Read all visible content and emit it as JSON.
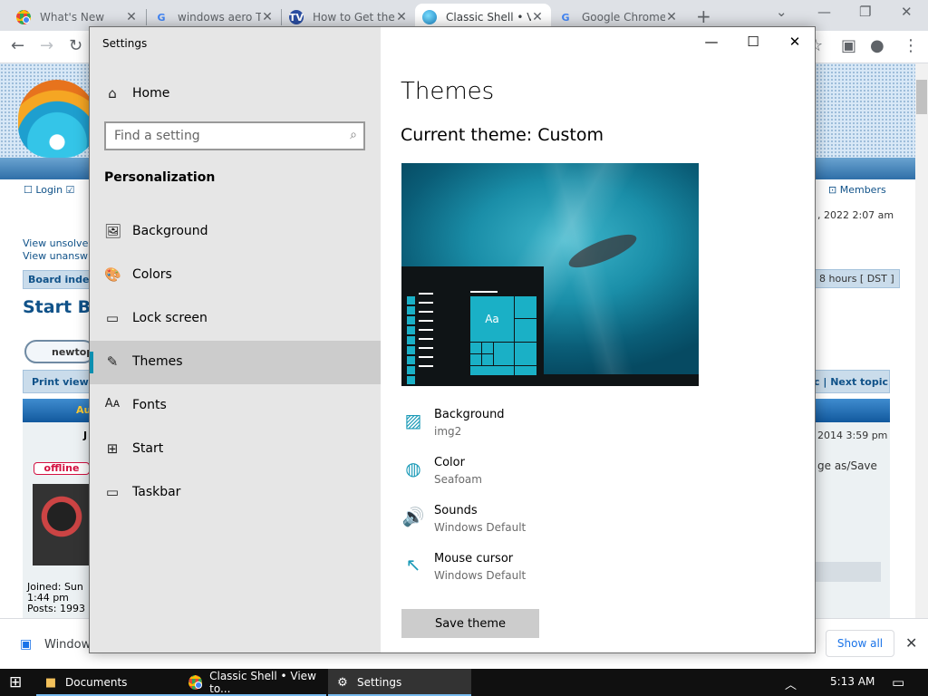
{
  "browser": {
    "tabs": [
      {
        "label": "What's New",
        "favicon": "chrome-icon"
      },
      {
        "label": "windows aero T",
        "favicon": "google-icon"
      },
      {
        "label": "How to Get the",
        "favicon": "tv-icon"
      },
      {
        "label": "Classic Shell • V",
        "favicon": "classic-shell-icon"
      },
      {
        "label": "Google Chrome",
        "favicon": "google-icon"
      }
    ],
    "active_tab": 3
  },
  "forum": {
    "login": "Login",
    "members": "Members",
    "date": ", 2022 2:07 am",
    "unsolved": "View unsolve",
    "unanswered": "View unansw",
    "board_index": "Board index",
    "timezone": "8 hours [ DST ]",
    "title": "Start Bu",
    "new_topic": "newtop",
    "print_view": "Print view",
    "next_topic": "c | Next topic",
    "blue_letters": "Au",
    "author_initial": "J",
    "post_date": "2014 3:59 pm",
    "post_snippet": "ge as/Save",
    "offline": "offline",
    "joined": "Joined: Sun",
    "joined_time": "1:44 pm",
    "posts": "Posts: 1993"
  },
  "downloads": {
    "item": "Windows",
    "show_all": "Show all"
  },
  "settings": {
    "window_title": "Settings",
    "home": "Home",
    "search_placeholder": "Find a setting",
    "section": "Personalization",
    "nav": [
      {
        "label": "Background",
        "icon": "picture-icon"
      },
      {
        "label": "Colors",
        "icon": "palette-icon"
      },
      {
        "label": "Lock screen",
        "icon": "lock-screen-icon"
      },
      {
        "label": "Themes",
        "icon": "brush-icon",
        "selected": true
      },
      {
        "label": "Fonts",
        "icon": "fonts-icon"
      },
      {
        "label": "Start",
        "icon": "start-icon"
      },
      {
        "label": "Taskbar",
        "icon": "taskbar-icon"
      }
    ],
    "heading": "Themes",
    "current_theme": "Current theme: Custom",
    "preview_tile_text": "Aa",
    "properties": [
      {
        "name": "Background",
        "value": "img2",
        "icon": "picture-icon"
      },
      {
        "name": "Color",
        "value": "Seafoam",
        "icon": "palette-icon"
      },
      {
        "name": "Sounds",
        "value": "Windows Default",
        "icon": "speaker-icon"
      },
      {
        "name": "Mouse cursor",
        "value": "Windows Default",
        "icon": "cursor-icon"
      }
    ],
    "save_theme": "Save theme",
    "accent_color": "#1a9ab7"
  },
  "taskbar": {
    "items": [
      {
        "label": "Documents",
        "icon": "folder-icon"
      },
      {
        "label": "Classic Shell • View to...",
        "icon": "chrome-icon"
      },
      {
        "label": "Settings",
        "icon": "gear-icon",
        "active": true
      }
    ],
    "time": "5:13 AM"
  }
}
